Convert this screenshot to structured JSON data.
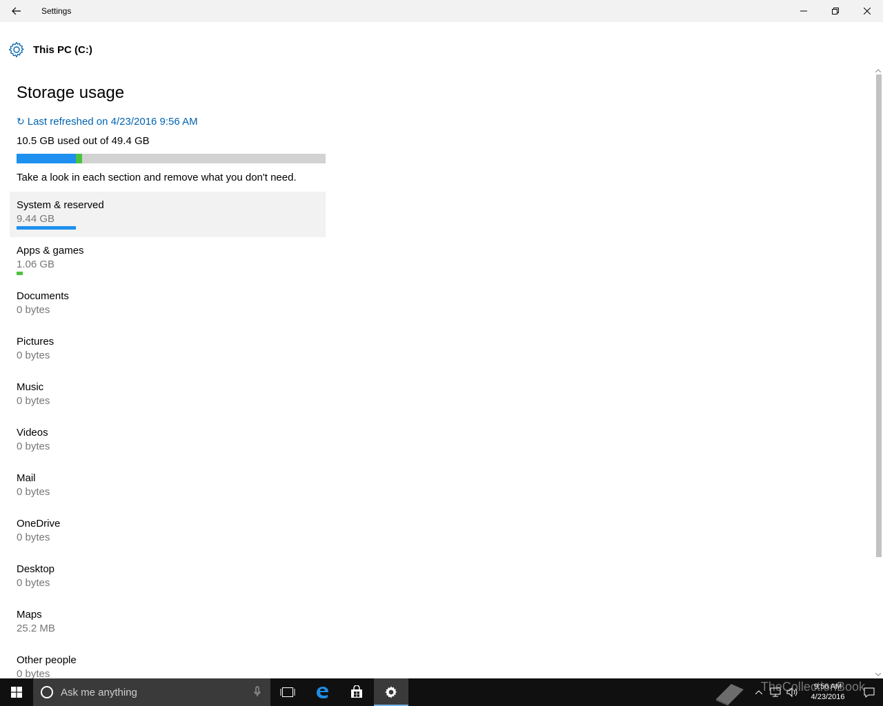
{
  "window": {
    "title": "Settings"
  },
  "header": {
    "title": "This PC (C:)"
  },
  "storage": {
    "title": "Storage usage",
    "refresh_icon": "↻",
    "refresh_text": "Last refreshed on 4/23/2016 9:56 AM",
    "used_text": "10.5 GB used out of 49.4 GB",
    "used_fraction_system": 0.191,
    "used_fraction_apps": 0.021,
    "hint": "Take a look in each section and remove what you don't need."
  },
  "categories": [
    {
      "name": "System & reserved",
      "size": "9.44 GB",
      "fraction": 0.191,
      "color": "#1e90ef"
    },
    {
      "name": "Apps & games",
      "size": "1.06 GB",
      "fraction": 0.021,
      "color": "#4cc23f"
    },
    {
      "name": "Documents",
      "size": "0 bytes"
    },
    {
      "name": "Pictures",
      "size": "0 bytes"
    },
    {
      "name": "Music",
      "size": "0 bytes"
    },
    {
      "name": "Videos",
      "size": "0 bytes"
    },
    {
      "name": "Mail",
      "size": "0 bytes"
    },
    {
      "name": "OneDrive",
      "size": "0 bytes"
    },
    {
      "name": "Desktop",
      "size": "0 bytes"
    },
    {
      "name": "Maps",
      "size": "25.2 MB"
    },
    {
      "name": "Other people",
      "size": "0 bytes"
    }
  ],
  "taskbar": {
    "search_placeholder": "Ask me anything",
    "time": "9:56 AM",
    "date": "4/23/2016",
    "watermark": "TheCollectionBook",
    "pinned": [
      "task-view-icon",
      "edge-icon",
      "store-icon",
      "settings-icon"
    ]
  },
  "colors": {
    "accent": "#0063b1",
    "system_bar": "#1e90ef",
    "apps_bar": "#4cc23f",
    "bar_track": "#d2d2d2"
  }
}
